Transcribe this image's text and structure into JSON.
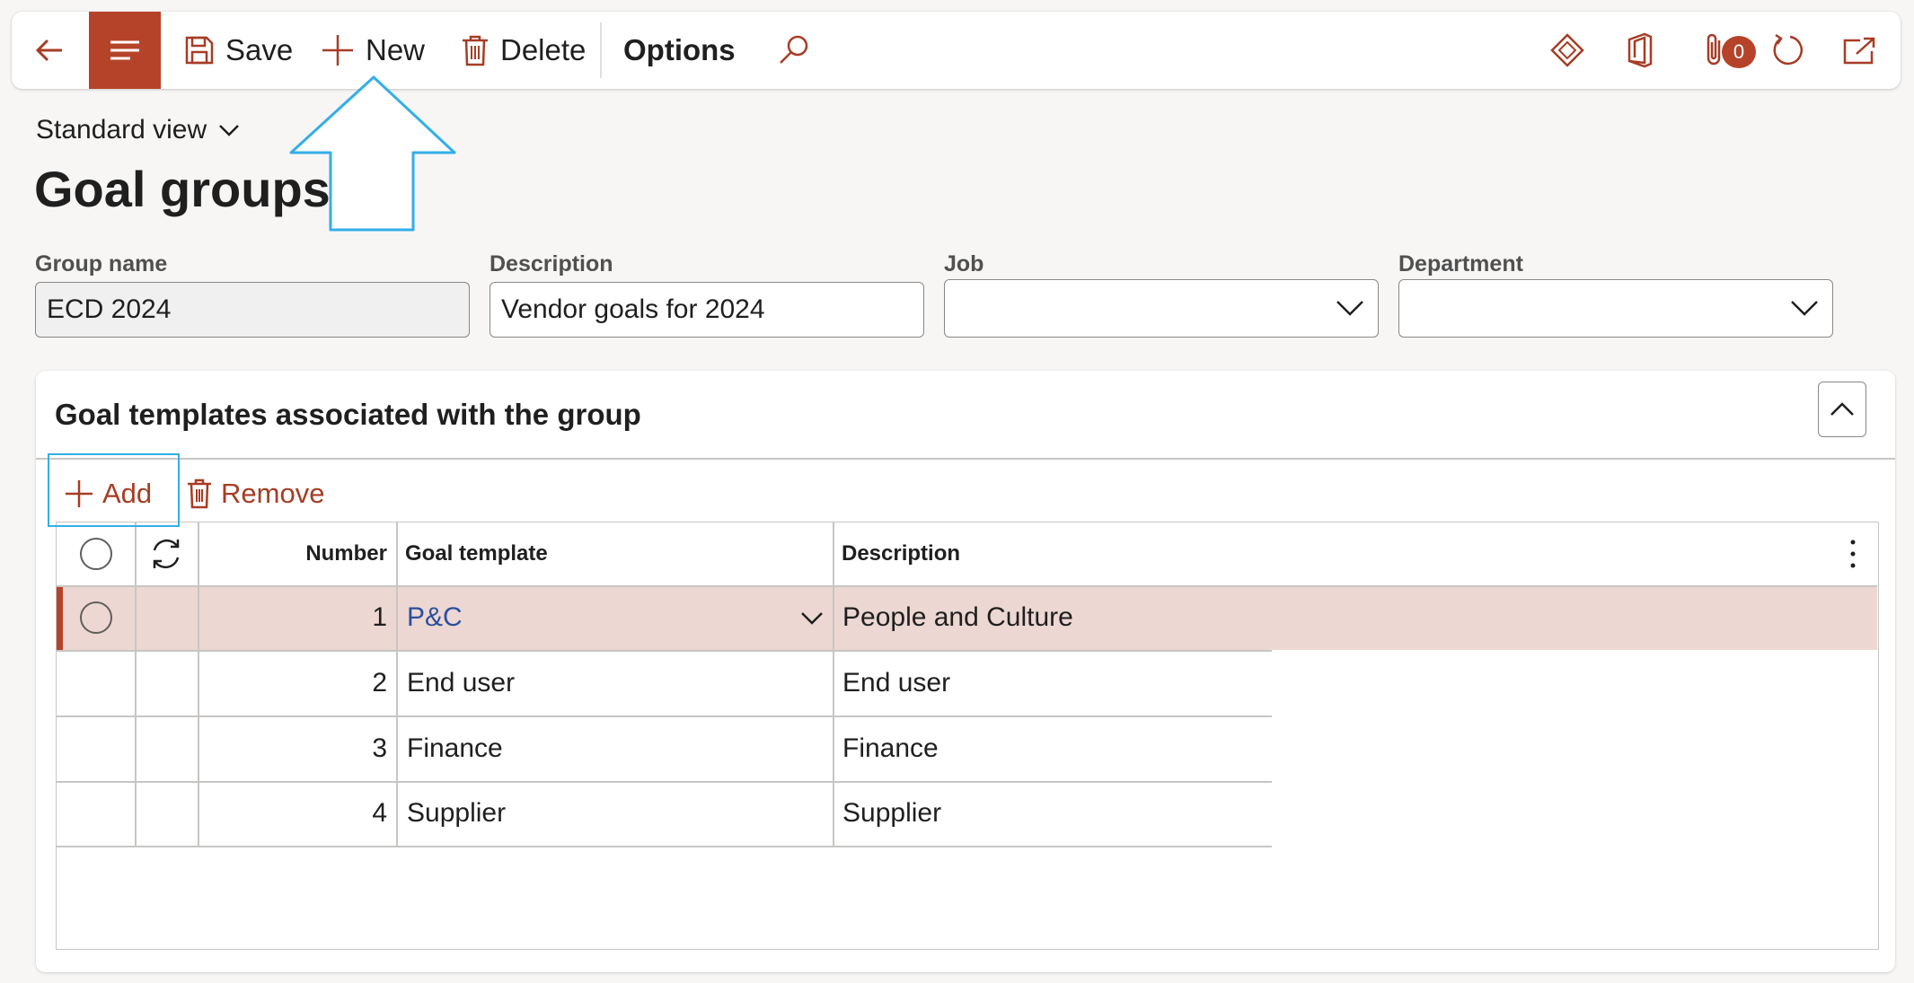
{
  "actionpane": {
    "back_label": "",
    "save_label": "Save",
    "new_label": "New",
    "delete_label": "Delete",
    "options_label": "Options",
    "attachments_count": "0"
  },
  "header": {
    "view_label": "Standard view",
    "page_title": "Goal groups"
  },
  "fields": {
    "group_name": {
      "label": "Group name",
      "value": "ECD 2024"
    },
    "description": {
      "label": "Description",
      "value": "Vendor goals for 2024"
    },
    "job": {
      "label": "Job",
      "value": ""
    },
    "department": {
      "label": "Department",
      "value": ""
    }
  },
  "fasttab": {
    "title": "Goal templates associated with the group",
    "add_label": "Add",
    "remove_label": "Remove"
  },
  "grid": {
    "columns": {
      "number": "Number",
      "goal_template": "Goal template",
      "description": "Description"
    },
    "rows": [
      {
        "number": "1",
        "goal_template": "P&C",
        "description": "People and Culture"
      },
      {
        "number": "2",
        "goal_template": "End user",
        "description": "End user"
      },
      {
        "number": "3",
        "goal_template": "Finance",
        "description": "Finance"
      },
      {
        "number": "4",
        "goal_template": "Supplier",
        "description": "Supplier"
      }
    ]
  },
  "colors": {
    "accent": "#b5432a",
    "selected_row": "#ecd7d2",
    "annotation": "#33aee8",
    "link": "#2b4fa0"
  },
  "icons": [
    "back-arrow-icon",
    "menu-icon",
    "save-icon",
    "plus-icon",
    "delete-icon",
    "search-icon",
    "power-apps-icon",
    "office-icon",
    "attachment-icon",
    "refresh-icon",
    "open-new-window-icon",
    "chevron-down-icon",
    "chevron-up-icon",
    "more-icon",
    "radio-circle-icon"
  ]
}
